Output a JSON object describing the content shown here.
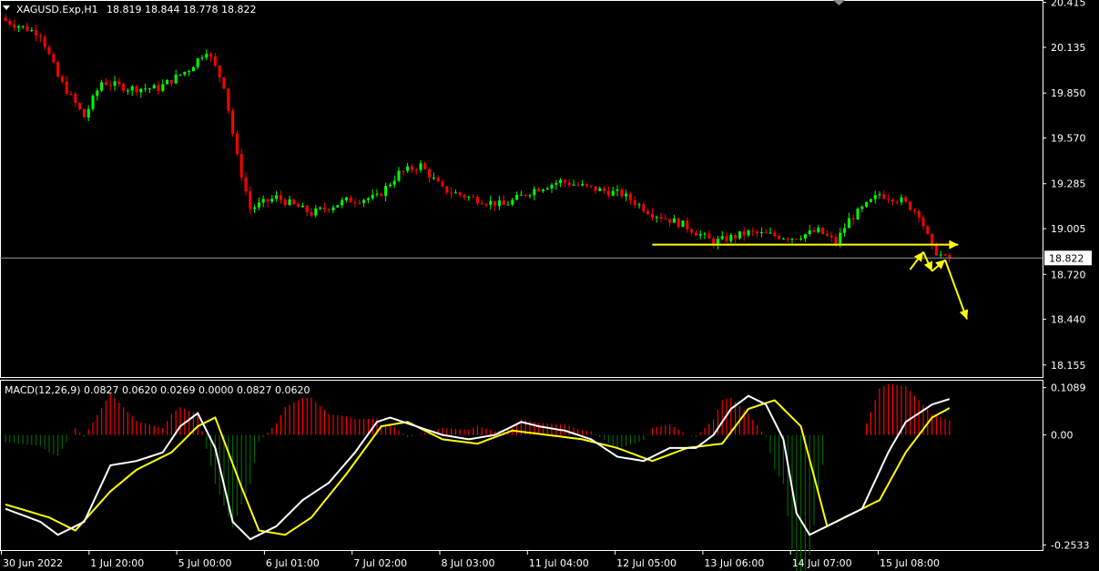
{
  "chart_data": [
    {
      "type": "candlestick",
      "header": {
        "symbol_tf": "XAGUSD.Exp,H1",
        "ohlc": "18.819 18.844 18.778 18.822"
      },
      "current_price": 18.822,
      "current_price_label": "18.822",
      "price_axis_ticks": [
        "20.415",
        "20.135",
        "19.850",
        "19.570",
        "19.285",
        "19.005",
        "18.720",
        "18.440",
        "18.155"
      ],
      "ylim": [
        18.08,
        20.43
      ],
      "time_axis_labels": [
        "30 Jun 2022",
        "1 Jul 20:00",
        "5 Jul 00:00",
        "6 Jul 01:00",
        "7 Jul 02:00",
        "8 Jul 03:00",
        "11 Jul 04:00",
        "12 Jul 05:00",
        "13 Jul 06:00",
        "14 Jul 07:00",
        "15 Jul 08:00"
      ],
      "bars_count": 217,
      "close_keypoints": [
        [
          0,
          20.3
        ],
        [
          8,
          20.22
        ],
        [
          12,
          19.95
        ],
        [
          18,
          19.7
        ],
        [
          22,
          19.92
        ],
        [
          28,
          19.88
        ],
        [
          35,
          19.88
        ],
        [
          42,
          20.0
        ],
        [
          46,
          20.12
        ],
        [
          50,
          19.9
        ],
        [
          53,
          19.45
        ],
        [
          56,
          19.13
        ],
        [
          62,
          19.2
        ],
        [
          70,
          19.1
        ],
        [
          78,
          19.18
        ],
        [
          85,
          19.2
        ],
        [
          90,
          19.35
        ],
        [
          95,
          19.4
        ],
        [
          100,
          19.25
        ],
        [
          106,
          19.2
        ],
        [
          114,
          19.15
        ],
        [
          121,
          19.25
        ],
        [
          127,
          19.3
        ],
        [
          135,
          19.25
        ],
        [
          141,
          19.22
        ],
        [
          148,
          19.1
        ],
        [
          155,
          19.03
        ],
        [
          162,
          18.92
        ],
        [
          170,
          18.98
        ],
        [
          180,
          18.95
        ],
        [
          186,
          18.99
        ],
        [
          190,
          18.92
        ],
        [
          193,
          19.06
        ],
        [
          197,
          19.15
        ],
        [
          200,
          19.22
        ],
        [
          205,
          19.18
        ],
        [
          209,
          19.1
        ],
        [
          212,
          18.88
        ],
        [
          215,
          18.82
        ],
        [
          216,
          18.822
        ]
      ],
      "bull_color": "#00ff00",
      "bear_color": "#ff0000",
      "annotation_color": "#ffff00",
      "annotations": [
        {
          "type": "arrow-line",
          "points": [
            [
              148,
              18.905
            ],
            [
              216,
              18.905
            ],
            [
              218,
              18.905
            ]
          ],
          "desc": "horizontal level arrow"
        },
        {
          "type": "arrow-path",
          "points": [
            [
              207,
              18.75
            ],
            [
              210,
              18.86
            ],
            [
              212,
              18.74
            ],
            [
              215,
              18.81
            ],
            [
              220,
              18.44
            ]
          ]
        }
      ]
    },
    {
      "type": "macd",
      "label": "MACD(12,26,9) 0.0827 0.0620 0.0269 0.0000 0.0827 0.0620",
      "ticks": [
        "0.1089",
        "0.00",
        "-0.2533"
      ],
      "tick_values": [
        0.1089,
        0.0,
        -0.2533
      ],
      "ylim": [
        -0.265,
        0.125
      ],
      "macd_keypoints": [
        [
          0,
          -0.17
        ],
        [
          8,
          -0.2
        ],
        [
          12,
          -0.23
        ],
        [
          18,
          -0.2
        ],
        [
          24,
          -0.07
        ],
        [
          30,
          -0.06
        ],
        [
          36,
          -0.04
        ],
        [
          40,
          0.02
        ],
        [
          44,
          0.05
        ],
        [
          48,
          -0.03
        ],
        [
          52,
          -0.2
        ],
        [
          56,
          -0.24
        ],
        [
          62,
          -0.21
        ],
        [
          68,
          -0.15
        ],
        [
          74,
          -0.11
        ],
        [
          80,
          -0.04
        ],
        [
          85,
          0.03
        ],
        [
          88,
          0.04
        ],
        [
          94,
          0.02
        ],
        [
          100,
          0.0
        ],
        [
          106,
          -0.01
        ],
        [
          112,
          0.0
        ],
        [
          118,
          0.03
        ],
        [
          122,
          0.02
        ],
        [
          128,
          0.01
        ],
        [
          134,
          -0.01
        ],
        [
          140,
          -0.05
        ],
        [
          146,
          -0.06
        ],
        [
          152,
          -0.03
        ],
        [
          158,
          -0.03
        ],
        [
          162,
          0.0
        ],
        [
          166,
          0.06
        ],
        [
          170,
          0.09
        ],
        [
          174,
          0.07
        ],
        [
          178,
          -0.01
        ],
        [
          181,
          -0.18
        ],
        [
          184,
          -0.23
        ],
        [
          190,
          -0.2
        ],
        [
          196,
          -0.17
        ],
        [
          202,
          -0.04
        ],
        [
          206,
          0.03
        ],
        [
          212,
          0.07
        ],
        [
          216,
          0.0827
        ]
      ],
      "signal_keypoints": [
        [
          0,
          -0.16
        ],
        [
          10,
          -0.19
        ],
        [
          16,
          -0.22
        ],
        [
          24,
          -0.13
        ],
        [
          30,
          -0.08
        ],
        [
          38,
          -0.04
        ],
        [
          44,
          0.02
        ],
        [
          48,
          0.04
        ],
        [
          54,
          -0.12
        ],
        [
          58,
          -0.22
        ],
        [
          64,
          -0.23
        ],
        [
          70,
          -0.19
        ],
        [
          78,
          -0.09
        ],
        [
          86,
          0.02
        ],
        [
          92,
          0.03
        ],
        [
          100,
          -0.01
        ],
        [
          108,
          -0.02
        ],
        [
          116,
          0.01
        ],
        [
          124,
          0.0
        ],
        [
          132,
          -0.01
        ],
        [
          140,
          -0.03
        ],
        [
          148,
          -0.06
        ],
        [
          156,
          -0.03
        ],
        [
          164,
          -0.02
        ],
        [
          170,
          0.06
        ],
        [
          176,
          0.08
        ],
        [
          182,
          0.02
        ],
        [
          188,
          -0.21
        ],
        [
          194,
          -0.18
        ],
        [
          200,
          -0.15
        ],
        [
          206,
          -0.04
        ],
        [
          212,
          0.04
        ],
        [
          216,
          0.062
        ]
      ],
      "macd_color": "#ffffff",
      "signal_color": "#ffff00",
      "hist_pos_color": "#ff0000",
      "hist_neg_color": "#006400"
    }
  ]
}
